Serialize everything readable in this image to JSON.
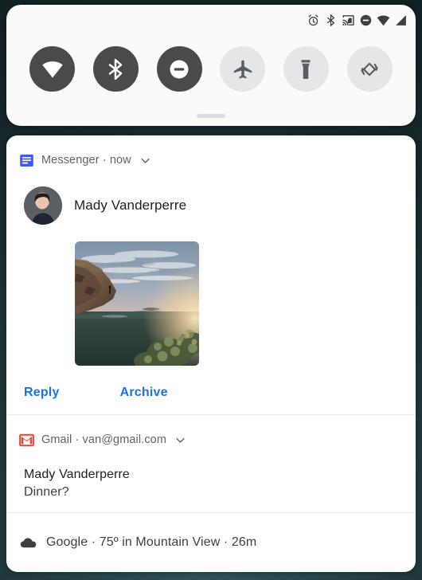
{
  "wallpaper": {
    "name": "dark-teal-landscape-wallpaper"
  },
  "status_bar": {
    "icons": [
      {
        "name": "alarm-icon",
        "label": "Alarm set"
      },
      {
        "name": "bluetooth-icon",
        "label": "Bluetooth on"
      },
      {
        "name": "cast-icon",
        "label": "Screen casting"
      },
      {
        "name": "do-not-disturb-icon",
        "label": "Do not disturb"
      },
      {
        "name": "wifi-icon",
        "label": "Wi-Fi connected"
      },
      {
        "name": "cellular-signal-icon",
        "label": "Cellular signal"
      }
    ]
  },
  "quick_settings": {
    "tiles": [
      {
        "name": "wifi-tile",
        "label": "Wi-Fi",
        "state": "on"
      },
      {
        "name": "bluetooth-tile",
        "label": "Bluetooth",
        "state": "on"
      },
      {
        "name": "do-not-disturb-tile",
        "label": "Do Not Disturb",
        "state": "on"
      },
      {
        "name": "airplane-mode-tile",
        "label": "Airplane mode",
        "state": "off"
      },
      {
        "name": "flashlight-tile",
        "label": "Flashlight",
        "state": "off"
      },
      {
        "name": "auto-rotate-tile",
        "label": "Auto-rotate",
        "state": "off"
      }
    ],
    "drag_handle": "drag-handle"
  },
  "notifications": [
    {
      "id": "messenger",
      "app_icon": "messenger-icon",
      "header": "Messenger · now",
      "sender": "Mady Vanderperre",
      "avatar": "contact-avatar",
      "image": "sunset-valley-photo",
      "actions": [
        {
          "name": "reply-button",
          "label": "Reply"
        },
        {
          "name": "archive-button",
          "label": "Archive"
        }
      ]
    },
    {
      "id": "gmail",
      "app_icon": "gmail-icon",
      "header": "Gmail · van@gmail.com",
      "title": "Mady Vanderperre",
      "body": "Dinner?"
    },
    {
      "id": "google",
      "app_icon": "cloud-icon",
      "header": "Google · 75º in Mountain View · 26m"
    }
  ],
  "colors": {
    "accent_blue": "#1a73e8",
    "tile_on": "#4a4a4a",
    "tile_off": "#e4e6e7",
    "panel_bg": "#ffffff",
    "qs_panel_bg": "#fafafa",
    "text_primary": "#202124",
    "text_secondary": "#5f6368",
    "background": "#16282a"
  }
}
